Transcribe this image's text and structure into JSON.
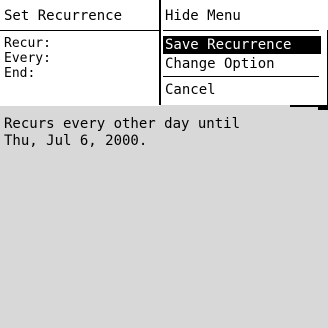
{
  "screen": {
    "title": "Set Recurrence"
  },
  "fields": {
    "recur_label": "Recur:",
    "every_label": "Every:",
    "end_label": "End:"
  },
  "summary": {
    "line1": "Recurs every other day until",
    "line2": "Thu, Jul 6, 2000."
  },
  "menu": {
    "items": [
      {
        "label": "Hide Menu",
        "selected": false
      },
      {
        "label": "Save Recurrence",
        "selected": true
      },
      {
        "label": "Change Option",
        "selected": false
      },
      {
        "label": "Cancel",
        "selected": false
      }
    ]
  }
}
